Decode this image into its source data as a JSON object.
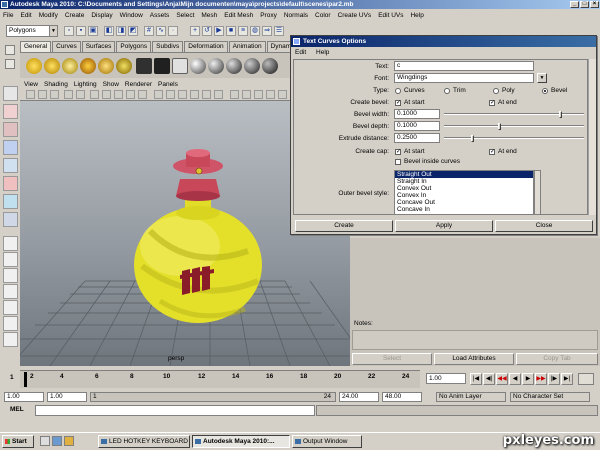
{
  "window": {
    "title": "Autodesk Maya 2010: C:\\Documents and Settings\\Anja\\Mijn documenten\\maya\\projects\\default\\scenes\\par2.mb",
    "controls": [
      "_",
      "□",
      "×"
    ]
  },
  "menubar": [
    "File",
    "Edit",
    "Modify",
    "Create",
    "Display",
    "Window",
    "Assets",
    "Select",
    "Mesh",
    "Edit Mesh",
    "Proxy",
    "Normals",
    "Color",
    "Create UVs",
    "Edit UVs",
    "Help"
  ],
  "status_line": {
    "mode_value": "Polygons"
  },
  "shelf_tabs": [
    "General",
    "Curves",
    "Surfaces",
    "Polygons",
    "Subdivs",
    "Deformation",
    "Animation",
    "Dynamics",
    "Re"
  ],
  "panel_menu": [
    "View",
    "Shading",
    "Lighting",
    "Show",
    "Renderer",
    "Panels"
  ],
  "viewport": {
    "camera_label": "persp"
  },
  "dialog": {
    "title": "Text Curves Options",
    "menu": [
      "Edit",
      "Help"
    ],
    "text_label": "Text:",
    "text_value": "c",
    "font_label": "Font:",
    "font_value": "Wingdings",
    "type_label": "Type:",
    "type_options": [
      {
        "label": "Curves",
        "selected": false
      },
      {
        "label": "Trim",
        "selected": false
      },
      {
        "label": "Poly",
        "selected": false
      },
      {
        "label": "Bevel",
        "selected": true
      }
    ],
    "create_bevel_label": "Create bevel:",
    "at_start_label": "At start",
    "at_end_label": "At end",
    "bevel_width_label": "Bevel width:",
    "bevel_width_value": "0.1000",
    "bevel_width_fraction": 0.85,
    "bevel_depth_label": "Bevel depth:",
    "bevel_depth_value": "0.1000",
    "bevel_depth_fraction": 0.4,
    "extrude_distance_label": "Extrude distance:",
    "extrude_distance_value": "0.2500",
    "extrude_distance_fraction": 0.2,
    "create_cap_label": "Create cap:",
    "cap_at_start_label": "At start",
    "cap_at_end_label": "At end",
    "bevel_inside_label": "Bevel inside curves",
    "outer_bevel_label": "Outer bevel style:",
    "outer_bevel_options": [
      "Straight Out",
      "Straight In",
      "Convex Out",
      "Convex In",
      "Concave Out",
      "Concave In"
    ],
    "outer_bevel_selected": "Straight Out",
    "buttons": {
      "create": "Create",
      "apply": "Apply",
      "close": "Close"
    }
  },
  "right_panel": {
    "notes_label": "Notes:",
    "buttons": {
      "select": "Select",
      "load_attributes": "Load Attributes",
      "copy_tab": "Copy Tab"
    }
  },
  "timeline": {
    "ticks": [
      "1",
      "2",
      "4",
      "6",
      "8",
      "10",
      "12",
      "14",
      "16",
      "18",
      "20",
      "22",
      "24"
    ],
    "current_frame": "1.00",
    "playback_icons": [
      "|◀",
      "◀|",
      "◀◀",
      "◀",
      "▶",
      "▶▶",
      "|▶",
      "▶|"
    ]
  },
  "range": {
    "start": "1.00",
    "playback_start": "1.00",
    "slider_start": "1",
    "slider_end": "24",
    "playback_end": "24.00",
    "end": "48.00",
    "anim_layer": "No Anim Layer",
    "character_set": "No Character Set"
  },
  "mel": {
    "label": "MEL"
  },
  "taskbar": {
    "start_label": "Start",
    "tasks": [
      "LED HOTKEY KEYBOARD",
      "Autodesk Maya 2010:...",
      "Output Window"
    ],
    "watermark": "pxleyes.com"
  }
}
